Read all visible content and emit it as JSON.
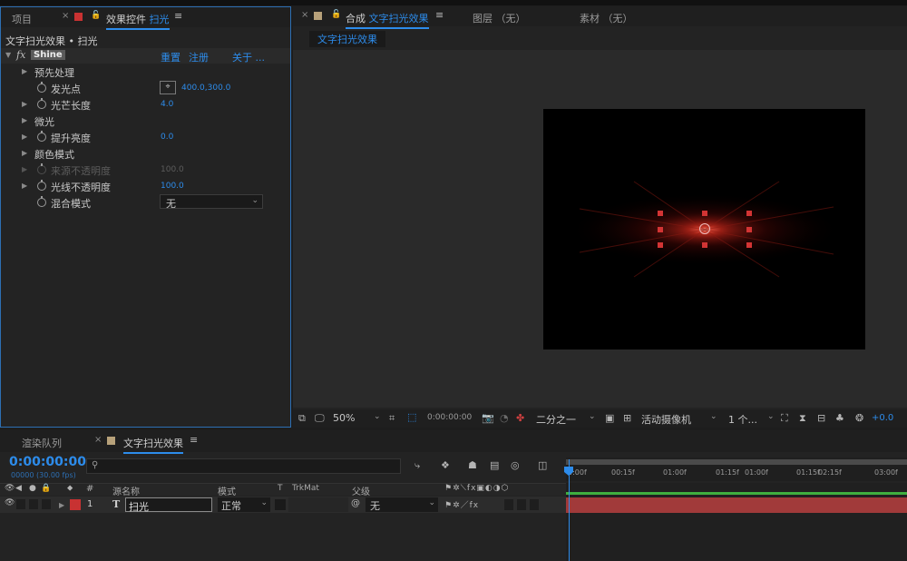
{
  "effects_panel": {
    "tab_project": "项目",
    "tab_effects_label": "效果控件",
    "tab_effects_target": "扫光",
    "header": "文字扫光效果 • 扫光",
    "effect_name": "Shine",
    "fx_label": "fx",
    "reset": "重置",
    "register": "注册",
    "about": "关于 ...",
    "rows": [
      {
        "label": "预先处理",
        "value": ""
      },
      {
        "label": "发光点",
        "value": "400.0,300.0"
      },
      {
        "label": "光芒长度",
        "value": "4.0"
      },
      {
        "label": "微光",
        "value": ""
      },
      {
        "label": "提升亮度",
        "value": "0.0"
      },
      {
        "label": "颜色模式",
        "value": ""
      },
      {
        "label": "来源不透明度",
        "value": "100.0"
      },
      {
        "label": "光线不透明度",
        "value": "100.0"
      },
      {
        "label": "混合模式",
        "value": "无"
      }
    ]
  },
  "comp_panel": {
    "tab_comp_label": "合成",
    "tab_comp_name": "文字扫光效果",
    "tab_layer": "图层 （无）",
    "tab_footage": "素材 （无）",
    "comp_chip": "文字扫光效果",
    "zoom": "50%",
    "timecode": "0:00:00:00",
    "resolution": "二分之一",
    "camera": "活动摄像机",
    "views": "1 个...",
    "exposure": "+0.0"
  },
  "timeline": {
    "tab_render": "渲染队列",
    "tab_comp": "文字扫光效果",
    "timecode": "0:00:00:00",
    "frame_info": "00000 (30.00 fps)",
    "search_placeholder": "",
    "columns": {
      "hash": "#",
      "source": "源名称",
      "mode": "模式",
      "t": "T",
      "trkmat": "TrkMat",
      "parent": "父级"
    },
    "layer": {
      "number": "1",
      "type": "T",
      "name": "扫光",
      "mode": "正常",
      "parent": "无"
    },
    "ruler_ticks": [
      "0:00f",
      "00:15f",
      "01:00f",
      "01:15f",
      "01:00f",
      "01:15f",
      "02:15f",
      "03:00f"
    ]
  },
  "colors": {
    "accent": "#2d8ceb",
    "label_red": "#c83232",
    "layer_bar": "#a13a3a",
    "handle": "#d23434"
  }
}
